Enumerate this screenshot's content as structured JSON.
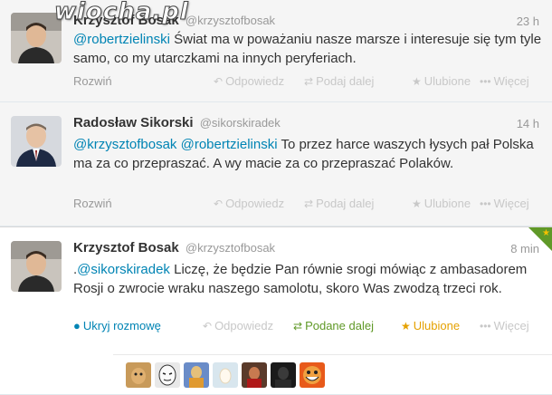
{
  "watermark": "wiocha.pl",
  "tweets": [
    {
      "name": "Krzysztof Bosak",
      "handle": "@krzysztofbosak",
      "time": "23 h",
      "mention1": "@robertzielinski",
      "text": " Świat ma w poważaniu nasze marsze i interesuje się tym tyle samo, co my utarczkami na innych peryferiach.",
      "expand": "Rozwiń",
      "reply": "Odpowiedz",
      "retweet": "Podaj dalej",
      "favorite": "Ulubione",
      "more": "Więcej"
    },
    {
      "name": "Radosław Sikorski",
      "handle": "@sikorskiradek",
      "time": "14 h",
      "mention1": "@krzysztofbosak",
      "mention2": "@robertzielinski",
      "text": " To przez harce waszych łysych pał Polska ma za co przepraszać. A wy macie za co przepraszać Polaków.",
      "expand": "Rozwiń",
      "reply": "Odpowiedz",
      "retweet": "Podaj dalej",
      "favorite": "Ulubione",
      "more": "Więcej"
    },
    {
      "name": "Krzysztof Bosak",
      "handle": "@krzysztofbosak",
      "time": "8 min",
      "prefix": ".",
      "mention1": "@sikorskiradek",
      "text": " Liczę, że będzie Pan równie srogi mówiąc z ambasadorem Rosji o zwrocie wraku naszego samolotu, skoro Was zwodzą trzeci rok.",
      "expand": "Ukryj rozmowę",
      "reply": "Odpowiedz",
      "retweet": "Podane dalej",
      "favorite": "Ulubione",
      "more": "Więcej"
    }
  ],
  "colors": {
    "link": "#0084b4",
    "retweeted": "#609928",
    "favorited": "#e5a100"
  },
  "icons": {
    "reply": "reply-icon",
    "retweet": "retweet-icon",
    "favorite": "star-icon",
    "more": "more-dots-icon",
    "conversation": "speech-bubble-icon"
  }
}
